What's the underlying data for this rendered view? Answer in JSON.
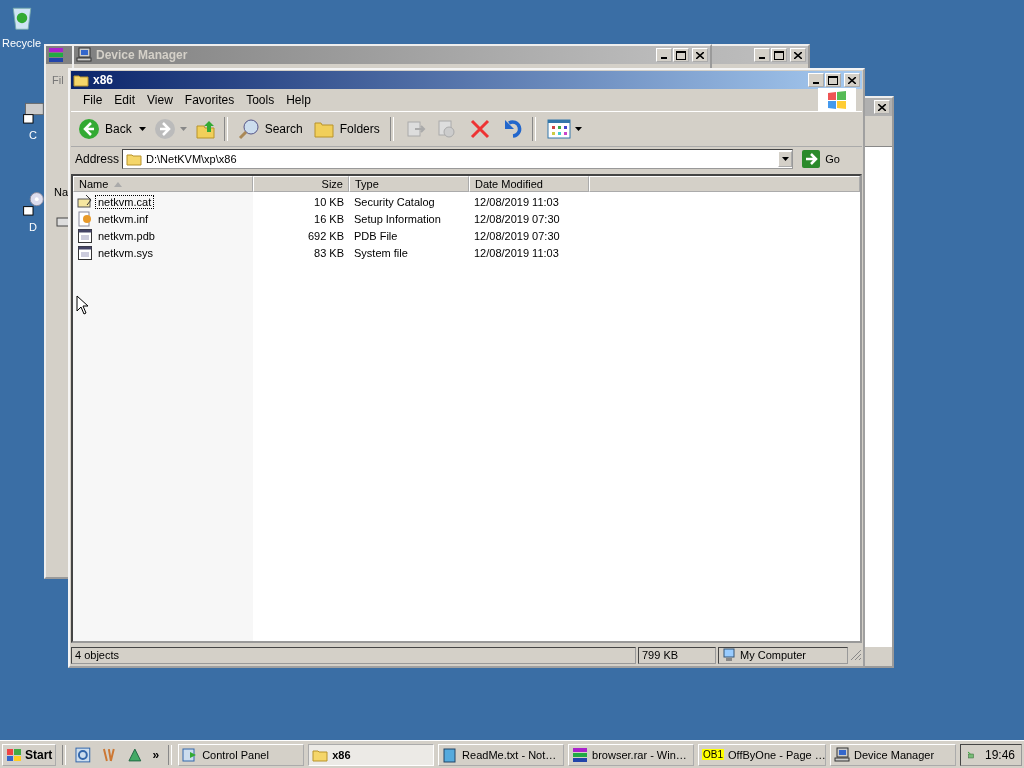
{
  "desktop_icons": [
    {
      "label": "Recycle",
      "kind": "recycle"
    },
    {
      "label": "C",
      "kind": "drive"
    },
    {
      "label": "D",
      "kind": "cd"
    }
  ],
  "background_windows": [
    {
      "kind": "archive",
      "menu_text": "Fil",
      "column_text": "Na"
    },
    {
      "kind": "device",
      "title": "Device Manager"
    },
    {
      "kind": "blank"
    }
  ],
  "window": {
    "title": "x86",
    "menu": [
      {
        "label": "File"
      },
      {
        "label": "Edit"
      },
      {
        "label": "View"
      },
      {
        "label": "Favorites"
      },
      {
        "label": "Tools"
      },
      {
        "label": "Help"
      }
    ],
    "toolbar": {
      "back": "Back",
      "search": "Search",
      "folders": "Folders"
    },
    "address": {
      "label": "Address",
      "value": "D:\\NetKVM\\xp\\x86",
      "go": "Go"
    },
    "columns": [
      {
        "label": "Name",
        "sorted": true
      },
      {
        "label": "Size",
        "sorted": false
      },
      {
        "label": "Type",
        "sorted": false
      },
      {
        "label": "Date Modified",
        "sorted": false
      }
    ],
    "rows": [
      {
        "kind": "catalog",
        "name": "netkvm.cat",
        "size": "10 KB",
        "type": "Security Catalog",
        "modified": "12/08/2019 11:03",
        "focused": true
      },
      {
        "kind": "setup",
        "name": "netkvm.inf",
        "size": "16 KB",
        "type": "Setup Information",
        "modified": "12/08/2019 07:30",
        "focused": false
      },
      {
        "kind": "system",
        "name": "netkvm.pdb",
        "size": "692 KB",
        "type": "PDB File",
        "modified": "12/08/2019 07:30",
        "focused": false
      },
      {
        "kind": "system",
        "name": "netkvm.sys",
        "size": "83 KB",
        "type": "System file",
        "modified": "12/08/2019 11:03",
        "focused": false
      }
    ],
    "status_bar": {
      "objects": "4 objects",
      "size": "799 KB",
      "zone": "My Computer"
    }
  },
  "taskbar": {
    "start": "Start",
    "more": "»",
    "tasks": [
      {
        "kind": "control",
        "label": "Control Panel",
        "selected": false
      },
      {
        "kind": "folder",
        "label": "x86",
        "selected": true
      },
      {
        "kind": "notepad",
        "label": "ReadMe.txt - Not…",
        "selected": false
      },
      {
        "kind": "archive",
        "label": "browser.rar - Win…",
        "selected": false
      },
      {
        "kind": "badge",
        "badge": "OB1",
        "label": "OffByOne - Page …",
        "selected": false
      },
      {
        "kind": "device",
        "label": "Device Manager",
        "selected": false
      }
    ],
    "clock": "19:46"
  }
}
